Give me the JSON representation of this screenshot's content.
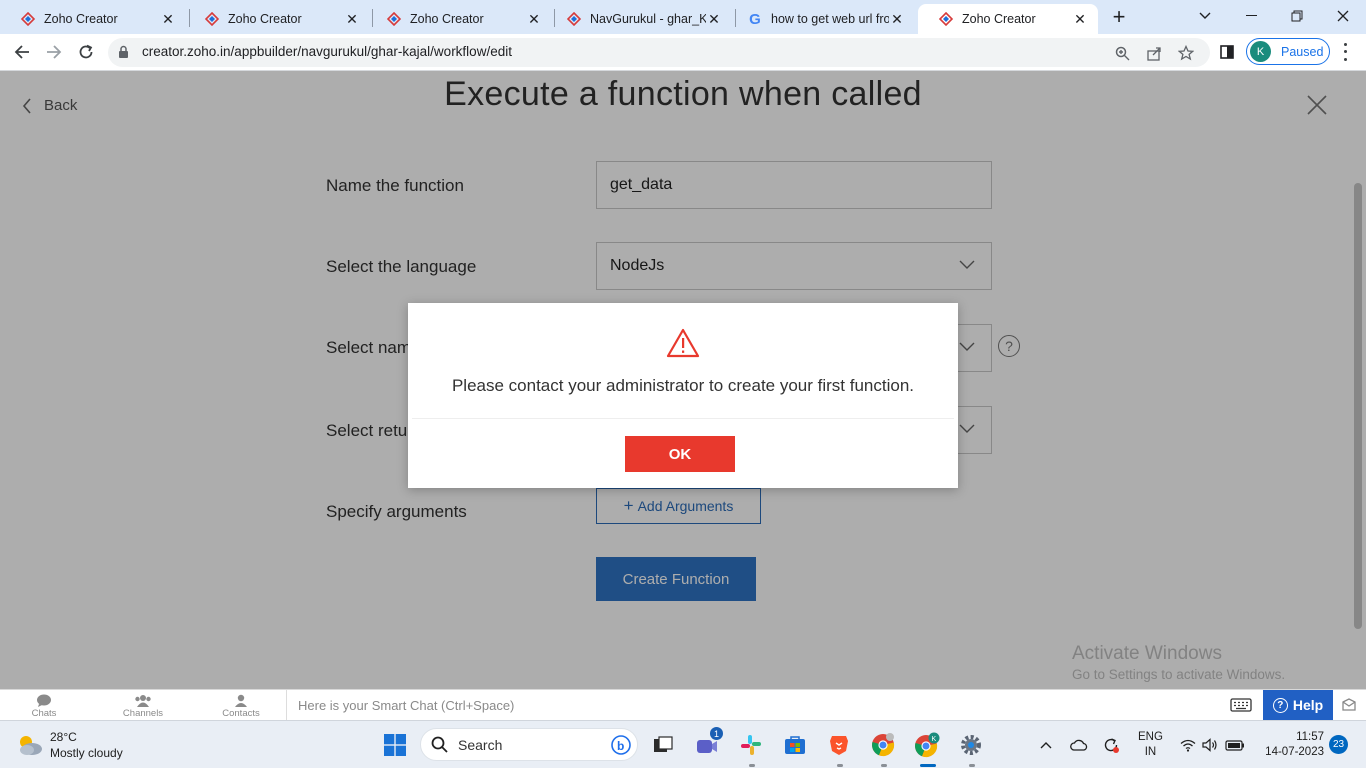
{
  "browser": {
    "tabs": [
      {
        "title": "Zoho Creator",
        "favicon": "zoho-icon",
        "active": false
      },
      {
        "title": "Zoho Creator",
        "favicon": "zoho-icon",
        "active": false
      },
      {
        "title": "Zoho Creator",
        "favicon": "zoho-icon",
        "active": false
      },
      {
        "title": "NavGurukul - ghar_Ka",
        "favicon": "zoho-icon",
        "active": false
      },
      {
        "title": "how to get web url fro",
        "favicon": "google-icon",
        "active": false
      },
      {
        "title": "Zoho Creator",
        "favicon": "zoho-icon",
        "active": true
      }
    ],
    "url": "creator.zoho.in/appbuilder/navgurukul/ghar-kajal/workflow/edit",
    "profile_initial": "K",
    "profile_status": "Paused"
  },
  "page": {
    "back_label": "Back",
    "title": "Execute a function when called",
    "rows": {
      "name": {
        "label": "Name the function",
        "value": "get_data"
      },
      "language": {
        "label": "Select the language",
        "value": "NodeJs"
      },
      "namespace": {
        "label": "Select namespace"
      },
      "return": {
        "label": "Select return type"
      },
      "arguments": {
        "label": "Specify arguments",
        "button": "Add Arguments"
      }
    },
    "create_button": "Create Function"
  },
  "modal": {
    "message": "Please contact your administrator to create your first function.",
    "ok_label": "OK",
    "accent_color": "#e8392d"
  },
  "watermark": {
    "line1": "Activate Windows",
    "line2": "Go to Settings to activate Windows."
  },
  "zoho_bar": {
    "items": [
      {
        "label": "Chats",
        "icon": "chat-bubble-icon"
      },
      {
        "label": "Channels",
        "icon": "channels-icon"
      },
      {
        "label": "Contacts",
        "icon": "contacts-icon"
      }
    ],
    "smart_chat_placeholder": "Here is your Smart Chat (Ctrl+Space)",
    "help_label": "Help"
  },
  "taskbar": {
    "weather_temp": "28°C",
    "weather_desc": "Mostly cloudy",
    "search_label": "Search",
    "meet_badge": "1",
    "lang_line1": "ENG",
    "lang_line2": "IN",
    "time": "11:57",
    "date": "14-07-2023",
    "notification_count": "23"
  }
}
